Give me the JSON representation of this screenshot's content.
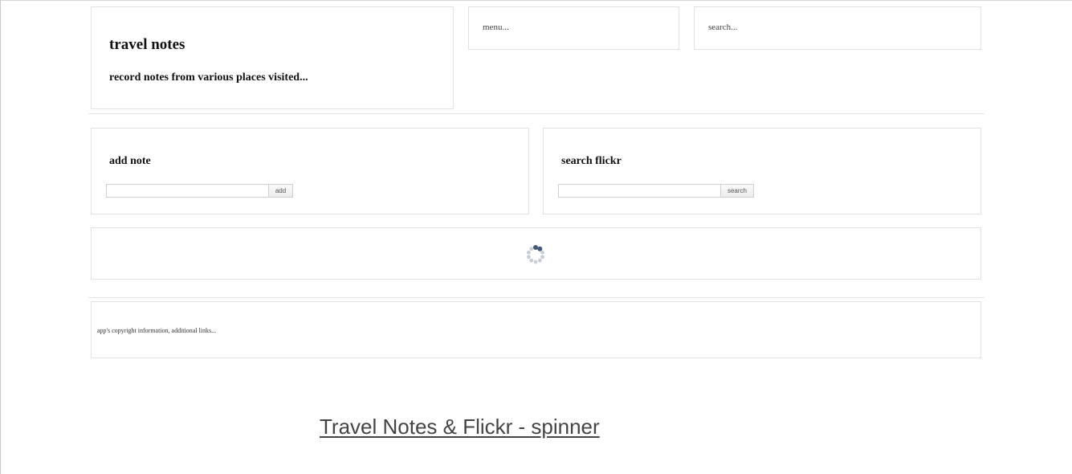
{
  "header": {
    "title": "travel notes",
    "subtitle": "record notes from various places visited..."
  },
  "menu": {
    "label": "menu..."
  },
  "search": {
    "label": "search..."
  },
  "add_note": {
    "title": "add note",
    "input_value": "",
    "button_label": "add"
  },
  "search_flickr": {
    "title": "search flickr",
    "input_value": "",
    "button_label": "search"
  },
  "loading": {
    "icon": "spinner-icon"
  },
  "footer": {
    "text": "app's copyright information, additional links..."
  },
  "caption": {
    "text": "Travel Notes & Flickr - spinner"
  },
  "colors": {
    "border": "#e1e1e1",
    "spinner_dark": "#3f5a7a",
    "spinner_light": "#c8ced6"
  }
}
